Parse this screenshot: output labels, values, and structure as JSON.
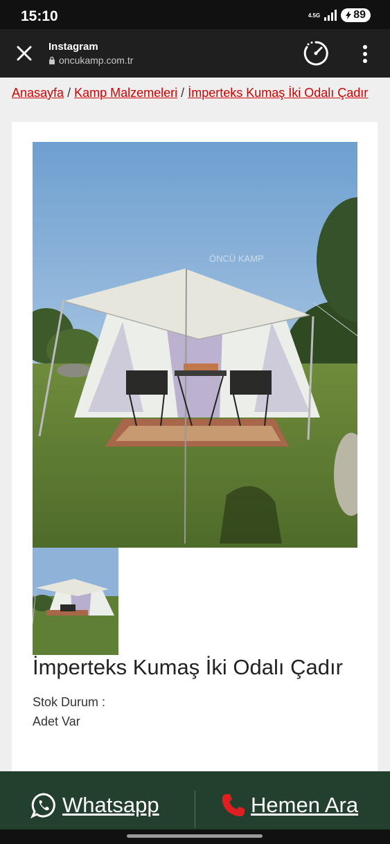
{
  "status_bar": {
    "time": "15:10",
    "network": "4.5G",
    "battery": "89",
    "icons": [
      "signal-icon",
      "battery-icon"
    ]
  },
  "browser": {
    "title": "Instagram",
    "url": "oncukamp.com.tr",
    "icons": [
      "close-icon",
      "lock-icon",
      "speedometer-icon",
      "more-vertical-icon"
    ]
  },
  "breadcrumb": {
    "items": [
      "Anasayfa",
      "Kamp Malzemeleri",
      "İmperteks Kumaş İki Odalı Çadır"
    ],
    "separator": "/"
  },
  "product": {
    "title": "İmperteks Kumaş İki Odalı Çadır",
    "stock_label": "Stok Durum :",
    "stock_value": "Adet Var",
    "watermark": "ÖNCÜ KAMP"
  },
  "actions": {
    "whatsapp_label": "Whatsapp",
    "call_label": "Hemen Ara",
    "icons": [
      "whatsapp-icon",
      "phone-icon"
    ]
  },
  "colors": {
    "link": "#d20000",
    "action_bar": "#23402f",
    "whatsapp_icon": "#ffffff",
    "phone_icon": "#e02020"
  }
}
